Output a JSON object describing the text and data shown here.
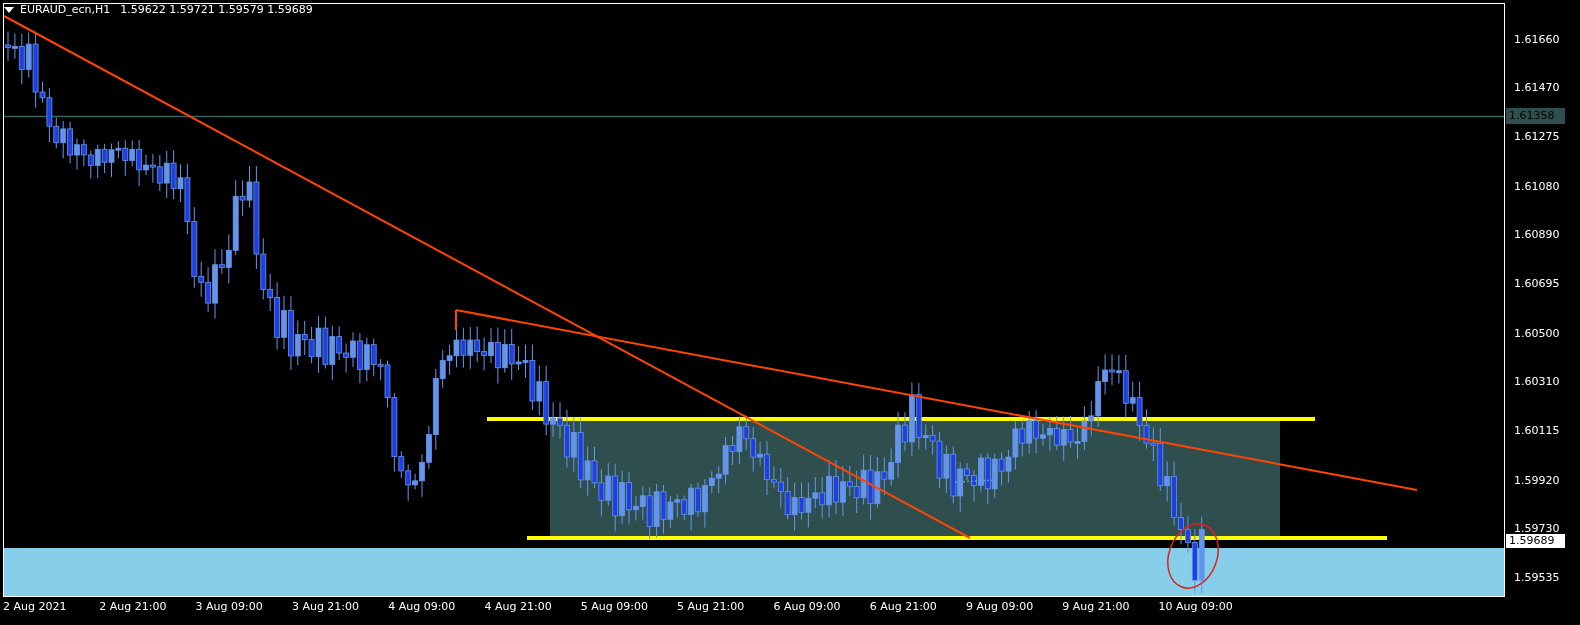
{
  "chart": {
    "symbol": "EURAUD_ecn,H1",
    "ohlc": [
      "1.59622",
      "1.59721",
      "1.59579",
      "1.59689"
    ],
    "price_axis": {
      "labels": [
        "1.61660",
        "1.61470",
        "1.61275",
        "1.61080",
        "1.60890",
        "1.60695",
        "1.60500",
        "1.60310",
        "1.60115",
        "1.59920",
        "1.59730",
        "1.59535"
      ],
      "line_marker": "1.61358",
      "current_price": "1.59689"
    },
    "time_axis": {
      "labels": [
        "2 Aug 2021",
        "2 Aug 21:00",
        "3 Aug 09:00",
        "3 Aug 21:00",
        "4 Aug 09:00",
        "4 Aug 21:00",
        "5 Aug 09:00",
        "5 Aug 21:00",
        "6 Aug 09:00",
        "6 Aug 21:00",
        "9 Aug 09:00",
        "9 Aug 21:00",
        "10 Aug 09:00"
      ]
    }
  }
}
